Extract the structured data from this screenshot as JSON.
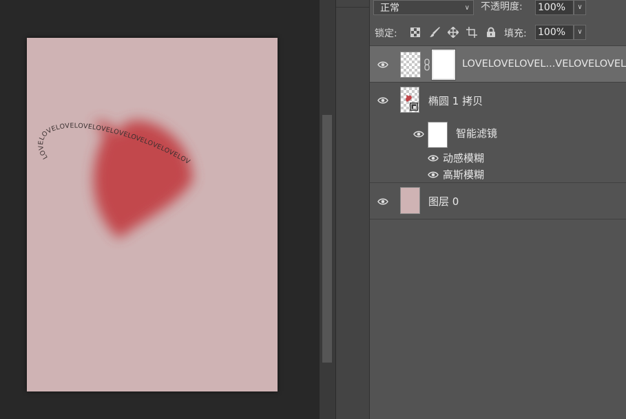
{
  "options_bar": {
    "blend_mode": "正常",
    "opacity_label": "不透明度:",
    "opacity_value": "100%",
    "lock_label": "锁定:",
    "fill_label": "填充:",
    "fill_value": "100%"
  },
  "layers": [
    {
      "name": "LOVELOVELOVEL...VELOVELOVELO",
      "selected": true
    },
    {
      "name": "椭圆 1 拷贝"
    },
    {
      "name": "智能滤镜"
    },
    {
      "name": "动感模糊"
    },
    {
      "name": "高斯模糊"
    },
    {
      "name": "图层 0"
    }
  ],
  "document": {
    "background_color": "#cfb3b4",
    "heart_color": "#c2454a",
    "text_path_upper": "LOVELOVELOVELOVELOVELOVELOVELOVELOVELOV",
    "text_path_lower": "LOVELOVELOVELOVELOVELOVELOVELOVELOVELOVELOVELOV"
  },
  "icons": {
    "lock_transparent": "checkerboard-icon",
    "lock_paint": "brush-icon",
    "lock_move": "move-icon",
    "lock_artboard": "crop-icon",
    "lock_all": "padlock-icon",
    "visibility": "eye-icon",
    "link": "chain-link-icon"
  }
}
